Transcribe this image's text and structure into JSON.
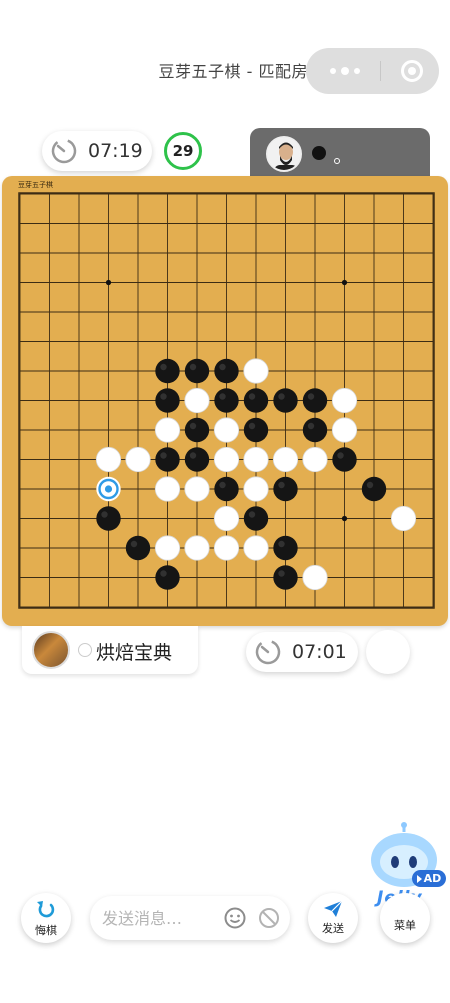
{
  "header": {
    "title": "豆芽五子棋 - 匹配房"
  },
  "players": {
    "opponent": {
      "timer": "07:19",
      "stone_color": "black"
    },
    "self": {
      "name": "烘焙宝典",
      "timer": "07:01",
      "stone_color": "white"
    }
  },
  "step_counter": "29",
  "board": {
    "logo_text": "豆芽五子棋",
    "size": 15,
    "star_points": [
      [
        3,
        3
      ],
      [
        3,
        11
      ],
      [
        11,
        11
      ]
    ],
    "black_stones": [
      [
        6,
        5
      ],
      [
        6,
        6
      ],
      [
        6,
        7
      ],
      [
        7,
        5
      ],
      [
        7,
        7
      ],
      [
        7,
        8
      ],
      [
        7,
        9
      ],
      [
        7,
        10
      ],
      [
        8,
        6
      ],
      [
        8,
        8
      ],
      [
        8,
        10
      ],
      [
        9,
        5
      ],
      [
        9,
        6
      ],
      [
        9,
        11
      ],
      [
        10,
        7
      ],
      [
        10,
        9
      ],
      [
        10,
        12
      ],
      [
        11,
        3
      ],
      [
        11,
        8
      ],
      [
        12,
        4
      ],
      [
        12,
        9
      ],
      [
        13,
        5
      ],
      [
        13,
        9
      ]
    ],
    "white_stones": [
      [
        6,
        8
      ],
      [
        7,
        6
      ],
      [
        7,
        11
      ],
      [
        8,
        5
      ],
      [
        8,
        7
      ],
      [
        8,
        11
      ],
      [
        9,
        3
      ],
      [
        9,
        4
      ],
      [
        9,
        7
      ],
      [
        9,
        8
      ],
      [
        9,
        9
      ],
      [
        9,
        10
      ],
      [
        10,
        5
      ],
      [
        10,
        6
      ],
      [
        10,
        8
      ],
      [
        11,
        7
      ],
      [
        11,
        13
      ],
      [
        12,
        5
      ],
      [
        12,
        6
      ],
      [
        12,
        7
      ],
      [
        12,
        8
      ],
      [
        13,
        10
      ]
    ],
    "last_move": [
      10,
      3
    ],
    "colors": {
      "wood": "#e3ae50",
      "line": "#3c2c14",
      "last_move_ring": "#2f9be6"
    }
  },
  "controls": {
    "undo_label": "悔棋",
    "message_placeholder": "发送消息…",
    "send_label": "发送",
    "menu_label": "菜单",
    "ad_label": "AD",
    "brand": "Jelly"
  },
  "icons": {
    "undo": "undo-arrow-icon",
    "send": "paper-plane-icon",
    "emoji": "smiley-icon",
    "ban": "no-entry-icon",
    "clock": "timer-icon"
  }
}
